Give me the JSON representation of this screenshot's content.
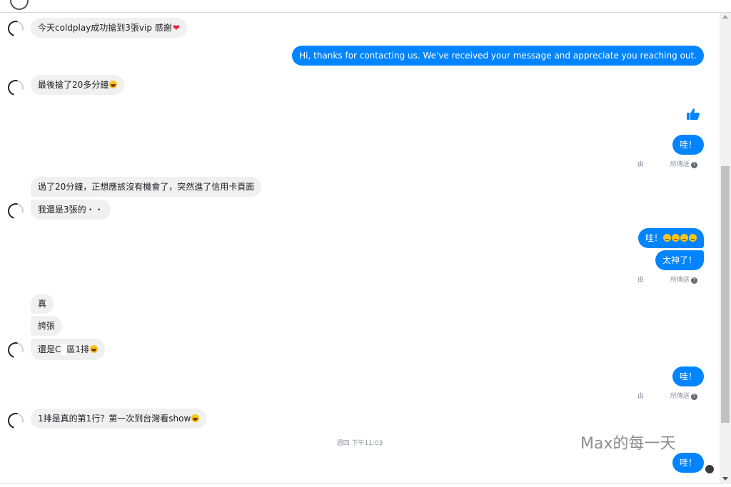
{
  "conversation": {
    "messages": {
      "m1": "今天coldplay成功搶到3張vip 感謝",
      "m2": "Hi, thanks for contacting us. We've received your message and appreciate you reaching out.",
      "m3": "最後搶了20多分鐘",
      "m4": "哇！",
      "m5": "過了20分鐘，正想應該沒有機會了，突然進了信用卡頁面",
      "m6": "我還是3張的・・",
      "m7": "哇！",
      "m8": "太神了！",
      "m9": "真",
      "m10": "誇張",
      "m11a": "還是C",
      "m11b": "區1排",
      "m12": "哇！",
      "m13": "1排是真的第1行？第一次到台灣看show",
      "m14": "哇！"
    },
    "seen_receipts": {
      "r1_a": "由 ",
      "r1_b": "所傳送",
      "r2_a": "由 ",
      "r2_b": "所傳送",
      "r3_a": "由 ",
      "r3_b": "所傳送"
    },
    "timestamp": "週四 下午11:03",
    "watermark": "Max的每一天"
  },
  "icons": {
    "like": "thumbs-up-icon",
    "help": "question-icon",
    "heart": "heart-icon",
    "laugh": "laughing-emoji",
    "blush": "flushed-emoji"
  },
  "colors": {
    "outgoing_bubble": "#0084ff",
    "incoming_bubble": "#f1f0f0",
    "meta_text": "#8d949e"
  }
}
